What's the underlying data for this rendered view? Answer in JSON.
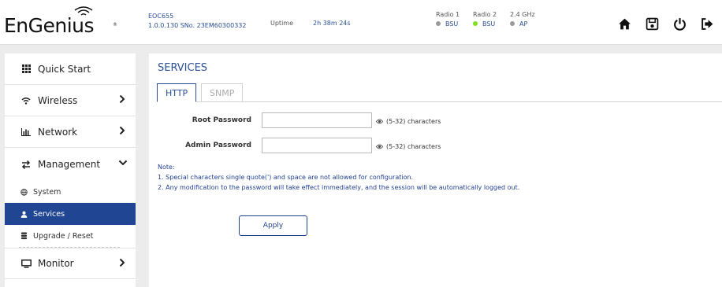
{
  "brand": {
    "logo_text": "EnGenius",
    "registered": "®"
  },
  "device": {
    "model": "EOC655",
    "firmware_serial": "1.0.0.130 SNo. 23EM60300332"
  },
  "uptime": {
    "label": "Uptime",
    "value": "2h 38m 24s"
  },
  "radios": [
    {
      "name": "Radio 1",
      "status": "BSU",
      "dot_color": "#9a9a9a"
    },
    {
      "name": "Radio 2",
      "status": "BSU",
      "dot_color": "#7fe020"
    },
    {
      "name": "2.4 GHz",
      "status": "AP",
      "dot_color": "#9a9a9a"
    }
  ],
  "header_icons": [
    "home-icon",
    "save-icon",
    "power-icon",
    "logout-icon"
  ],
  "sidebar": {
    "items": [
      {
        "label": "Quick Start",
        "icon": "grid-icon",
        "chevron": ""
      },
      {
        "label": "Wireless",
        "icon": "wifi-icon",
        "chevron": "›"
      },
      {
        "label": "Network",
        "icon": "bar-chart-icon",
        "chevron": "›"
      },
      {
        "label": "Management",
        "icon": "arrows-icon",
        "chevron": "⌄"
      },
      {
        "label": "Monitor",
        "icon": "monitor-icon",
        "chevron": "›"
      }
    ],
    "sub_items": [
      {
        "label": "System",
        "icon": "globe-icon"
      },
      {
        "label": "Services",
        "icon": "user-icon"
      },
      {
        "label": "Upgrade / Reset",
        "icon": "database-icon"
      }
    ]
  },
  "main": {
    "title": "SERVICES",
    "tabs": [
      {
        "label": "HTTP",
        "active": true
      },
      {
        "label": "SNMP",
        "active": false
      }
    ],
    "fields": [
      {
        "label": "Root Password",
        "value": "",
        "hint": "(5-32) characters"
      },
      {
        "label": "Admin Password",
        "value": "",
        "hint": "(5-32) characters"
      }
    ],
    "note": {
      "title": "Note:",
      "lines": [
        "1. Special characters single quote(') and space are not allowed for configuration.",
        "2. Any modification to the password will take effect immediately, and the session will be automatically logged out."
      ]
    },
    "apply_label": "Apply"
  },
  "colors": {
    "accent": "#2a4f96",
    "active_bg": "#1f4593",
    "page_bg": "#ececec"
  }
}
